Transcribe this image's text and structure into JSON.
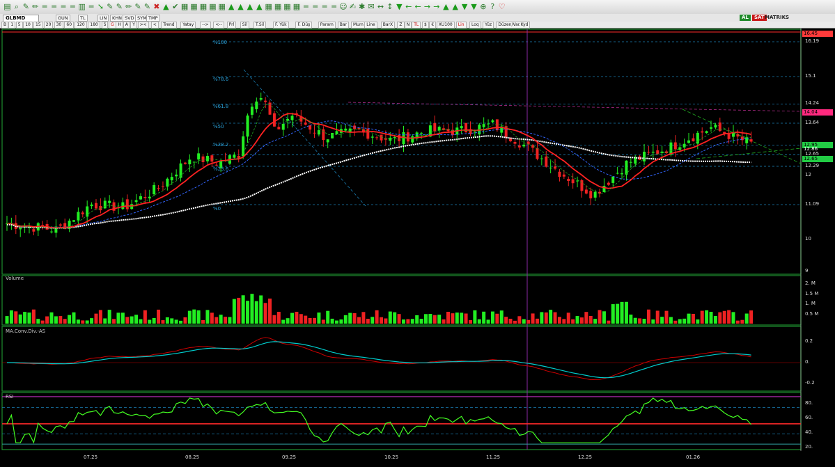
{
  "toolbar": {
    "icons": [
      "doc-icon",
      "search-icon",
      "draw-icon",
      "pencil-icon",
      "line-icon",
      "line-icon",
      "line-icon",
      "line-icon",
      "chart-icon",
      "line-icon",
      "arrow-icon",
      "draw-icon",
      "draw-icon",
      "pencil-icon",
      "draw-icon",
      "draw-icon",
      "x-icon",
      "up-arrow-icon",
      "check-icon",
      "grid-icon",
      "grid-icon",
      "grid-icon",
      "grid-icon",
      "grid-icon",
      "up-arrow-icon",
      "up-arrow-icon",
      "up-arrow-icon",
      "up-arrow-icon",
      "grid-icon",
      "grid-icon",
      "grid-icon",
      "grid-icon",
      "line-icon",
      "line-icon",
      "line-icon",
      "line-icon",
      "face-icon",
      "brush-icon",
      "bulb-icon",
      "comment-icon",
      "left-right-icon",
      "up-down-icon",
      "down-arrow-icon",
      "left-arrow-icon",
      "left-arrow-icon",
      "right-arrow-icon",
      "right-arrow-icon",
      "up-arrow-icon",
      "up-arrow-icon",
      "down-arrow-icon",
      "down-arrow-icon",
      "zoom-icon",
      "help-icon",
      "heart-icon"
    ]
  },
  "symbol_bar": {
    "symbol": "GLBMD",
    "period": "GUN",
    "currency": "TL",
    "scale": "LIN",
    "buttons": [
      "KHN",
      "SVD",
      "SYM",
      "TMP"
    ],
    "al_label": "AL",
    "sat_label": "SAT",
    "brand": "MATRIKS"
  },
  "period_bar": {
    "items": [
      "B",
      "1",
      "5",
      "10",
      "15",
      "20",
      "30",
      "60",
      "120",
      "180",
      "S",
      "G",
      "H",
      "A",
      "Y",
      ">< ",
      "<"
    ],
    "items2": [
      "Trend",
      "Yatay",
      "-->",
      "<--",
      "Prl",
      "Sil",
      "T.Sil",
      "F. Yük",
      "F. Düş",
      "Param",
      "Bar",
      "Mum",
      "Line",
      "BarX",
      "Z",
      "N",
      "TL",
      "$",
      "€",
      "XU100",
      "Lin",
      "Loq",
      "Yüz",
      "Düzen/Var.Kyd"
    ]
  },
  "price_panel": {
    "fib_labels": [
      "%100",
      "%78.6",
      "%61.8",
      "%50",
      "%38.2",
      "%23.6",
      "%0"
    ],
    "axis_labels": [
      "16.19",
      "15.1",
      "14.24",
      "13.64",
      "12.65",
      "12.29",
      "12",
      "11.09",
      "10",
      "9"
    ],
    "badges": [
      {
        "text": "16.45",
        "color": "#ff3b3b"
      },
      {
        "text": "14.04",
        "color": "#ff2a7f"
      },
      {
        "text": "12.95",
        "color": "#22cc44"
      },
      {
        "text": "12.86",
        "color": "#dddddd"
      },
      {
        "text": "12.65",
        "color": "#22cc44"
      }
    ]
  },
  "volume_panel": {
    "label": "Volume",
    "axis_labels": [
      "2. M",
      "1.5 M",
      "1. M",
      "0.5 M"
    ]
  },
  "macd_panel": {
    "label": "MA.Conv.Div.-AS",
    "axis_labels": [
      "0.2",
      "0.",
      "-0.2"
    ]
  },
  "rsi_panel": {
    "label": "RSI",
    "axis_labels": [
      "80.",
      "60.",
      "40.",
      "20."
    ]
  },
  "dates": [
    "07.25",
    "08.25",
    "09.25",
    "10.25",
    "11.25",
    "12.25",
    "01.26"
  ],
  "colors": {
    "up": "#22ee22",
    "down": "#ee2222",
    "ma_white": "#ffffff",
    "ma_red": "#ff2222",
    "ma_blue": "#3366ff",
    "macd": "#00cccc",
    "signal": "#cc0000",
    "rsi": "#44ff22"
  }
}
